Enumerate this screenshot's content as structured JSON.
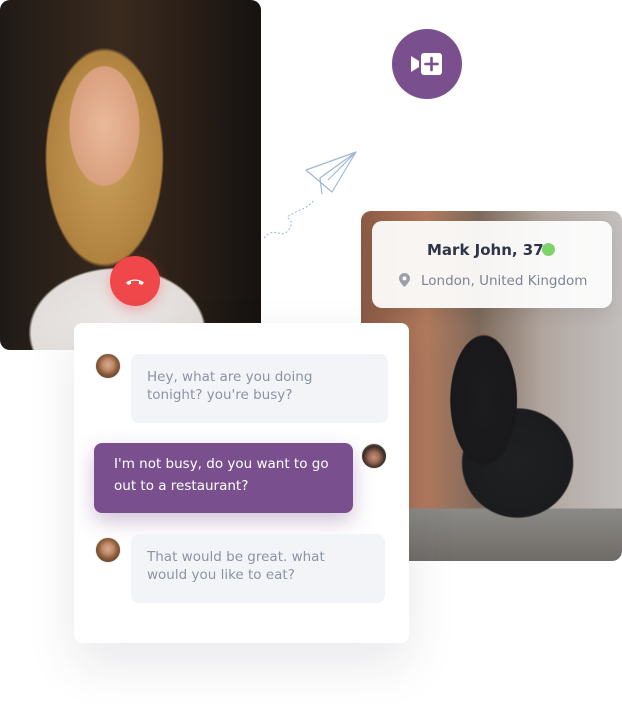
{
  "profile": {
    "name": "Mark John, 37",
    "location": "London, United Kingdom",
    "online_color": "#7ed36b"
  },
  "call": {
    "end_call_icon": "phone-hangup-icon",
    "add_video_icon": "video-add-icon",
    "end_call_color": "#f0474a",
    "accent_color": "#7a4f8e"
  },
  "chat": {
    "messages": [
      {
        "from": "woman",
        "text": "Hey, what are you doing tonight? you're busy?"
      },
      {
        "from": "man",
        "text": "I'm not busy, do you want to go out to a restaurant?"
      },
      {
        "from": "woman",
        "text": "That would be great. what would you like to eat?"
      }
    ]
  }
}
